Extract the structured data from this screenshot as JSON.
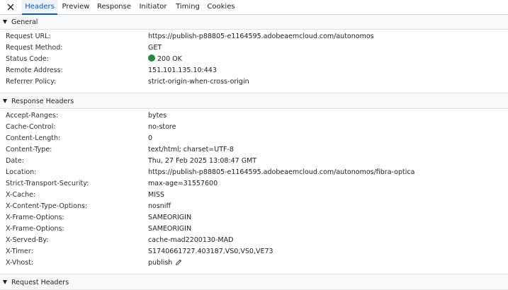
{
  "tabs": [
    "Headers",
    "Preview",
    "Response",
    "Initiator",
    "Timing",
    "Cookies"
  ],
  "active_tab": "Headers",
  "general": {
    "title": "General",
    "request_url": {
      "key": "Request URL:",
      "value": "https://publish-p88805-e1164595.adobeaemcloud.com/autonomos"
    },
    "request_method": {
      "key": "Request Method:",
      "value": "GET"
    },
    "status_code": {
      "key": "Status Code:",
      "value": "200 OK",
      "status_color": "#1e8e3e"
    },
    "remote_address": {
      "key": "Remote Address:",
      "value": "151.101.135.10:443"
    },
    "referrer_policy": {
      "key": "Referrer Policy:",
      "value": "strict-origin-when-cross-origin"
    }
  },
  "response_headers": {
    "title": "Response Headers",
    "items": [
      {
        "key": "Accept-Ranges:",
        "value": "bytes"
      },
      {
        "key": "Cache-Control:",
        "value": "no-store"
      },
      {
        "key": "Content-Length:",
        "value": "0"
      },
      {
        "key": "Content-Type:",
        "value": "text/html; charset=UTF-8"
      },
      {
        "key": "Date:",
        "value": "Thu, 27 Feb 2025 13:08:47 GMT"
      },
      {
        "key": "Location:",
        "value": "https://publish-p88805-e1164595.adobeaemcloud.com/autonomos/fibra-optica"
      },
      {
        "key": "Strict-Transport-Security:",
        "value": "max-age=31557600"
      },
      {
        "key": "X-Cache:",
        "value": "MISS"
      },
      {
        "key": "X-Content-Type-Options:",
        "value": "nosniff"
      },
      {
        "key": "X-Frame-Options:",
        "value": "SAMEORIGIN"
      },
      {
        "key": "X-Frame-Options:",
        "value": "SAMEORIGIN"
      },
      {
        "key": "X-Served-By:",
        "value": "cache-mad2200130-MAD"
      },
      {
        "key": "X-Timer:",
        "value": "S1740661727.403187,VS0,VS0,VE73"
      },
      {
        "key": "X-Vhost:",
        "value": "publish"
      }
    ]
  },
  "request_headers": {
    "title": "Request Headers"
  },
  "colors": {
    "accent": "#0b57d0",
    "active_tab_bg": "#eef2f9",
    "section_bg": "#f8f9fb",
    "divider": "#e0e0e0"
  },
  "icons": {
    "close": "close-icon",
    "expand": "triangle-down-icon",
    "edit": "pencil-icon",
    "status": "status-dot-icon"
  }
}
